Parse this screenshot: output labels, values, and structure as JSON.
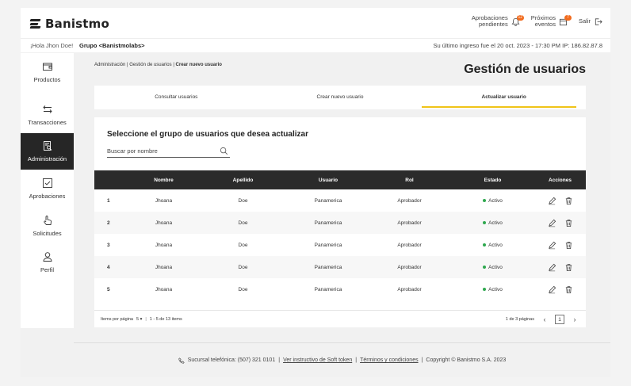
{
  "brand": {
    "name": "Banistmo"
  },
  "topnav": {
    "approvals": {
      "label_line1": "Aprobaciones",
      "label_line2": "pendientes",
      "count": "12"
    },
    "events": {
      "label_line1": "Próximos",
      "label_line2": "eventos",
      "count": "7"
    },
    "logout": "Salir"
  },
  "subbar": {
    "greeting": "¡Hola Jhon Doe!",
    "group": "Grupo <Banistmolabs>",
    "last_login": "Su último ingreso fue el 20 oct. 2023 - 17:30 PM IP: 186.82.87.8"
  },
  "sidebar": {
    "items": [
      {
        "label": "Productos",
        "icon": "wallet-icon",
        "active": false
      },
      {
        "label": "Transacciones",
        "icon": "transfer-arrows-icon",
        "active": false
      },
      {
        "label": "Administración",
        "icon": "admin-document-search-icon",
        "active": true
      },
      {
        "label": "Aprobaciones",
        "icon": "checkbox-icon",
        "active": false
      },
      {
        "label": "Solicitudes",
        "icon": "hand-pointer-icon",
        "active": false
      },
      {
        "label": "Perfil",
        "icon": "user-icon",
        "active": false
      }
    ]
  },
  "breadcrumb": {
    "item1": "Administración",
    "item2": "Gestión de usuarios",
    "item3": "Crear nuevo usuario",
    "separator": "|"
  },
  "page_title": "Gestión de usuarios",
  "tabs": [
    {
      "label": "Consultar usuarios",
      "active": false
    },
    {
      "label": "Crear nuevo usuario",
      "active": false
    },
    {
      "label": "Actualizar usuario",
      "active": true
    }
  ],
  "card": {
    "title": "Seleccione el grupo de usuarios que desea actualizar",
    "search_placeholder": "Buscar por nombre"
  },
  "table": {
    "headers": {
      "nombre": "Nombre",
      "apellido": "Apellido",
      "usuario": "Usuario",
      "rol": "Rol",
      "estado": "Estado",
      "acciones": "Acciones"
    },
    "rows": [
      {
        "num": "1",
        "nombre": "Jhoana",
        "apellido": "Doe",
        "usuario": "Panamerica",
        "rol": "Aprobador",
        "estado": "Activo"
      },
      {
        "num": "2",
        "nombre": "Jhoana",
        "apellido": "Doe",
        "usuario": "Panamerica",
        "rol": "Aprobador",
        "estado": "Activo"
      },
      {
        "num": "3",
        "nombre": "Jhoana",
        "apellido": "Doe",
        "usuario": "Panamerica",
        "rol": "Aprobador",
        "estado": "Activo"
      },
      {
        "num": "4",
        "nombre": "Jhoana",
        "apellido": "Doe",
        "usuario": "Panamerica",
        "rol": "Aprobador",
        "estado": "Activo"
      },
      {
        "num": "5",
        "nombre": "Jhoana",
        "apellido": "Doe",
        "usuario": "Panamerica",
        "rol": "Aprobador",
        "estado": "Activo"
      }
    ],
    "status_color": "#2fa84f"
  },
  "pager": {
    "items_per_page_label": "Items por página",
    "items_per_page": "5",
    "range": "1 - 5 de 13 items",
    "pages_label": "1 de 3 páginas",
    "current_page": "1"
  },
  "footer": {
    "phone": "Sucursal telefónica: (507) 321 0101",
    "link1": "Ver instructivo de Soft token",
    "link2": "Términos y condiciones",
    "copyright": "Copyright © Banistmo S.A. 2023"
  },
  "colors": {
    "accent": "#f0c419",
    "dark": "#262626",
    "badge": "#f26b1d"
  }
}
